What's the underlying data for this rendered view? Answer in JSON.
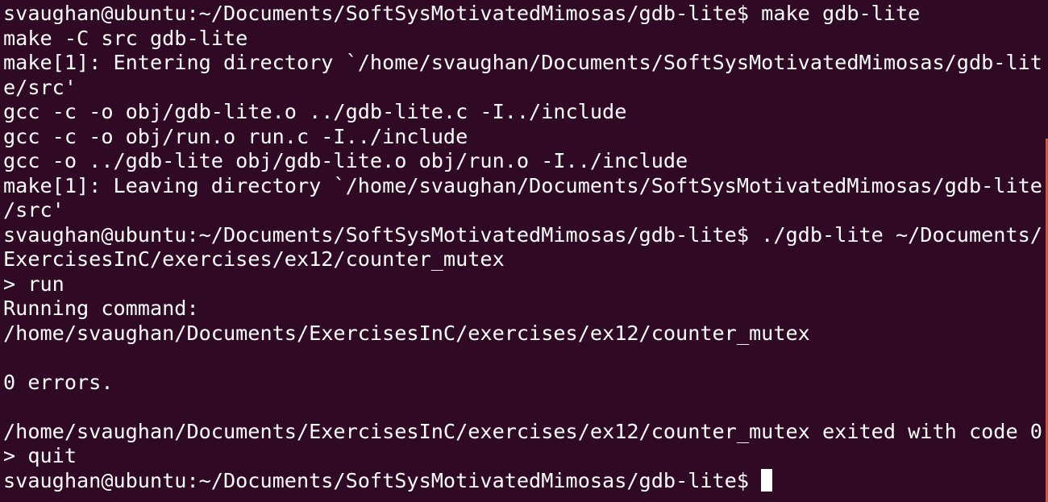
{
  "terminal": {
    "lines": [
      "svaughan@ubuntu:~/Documents/SoftSysMotivatedMimosas/gdb-lite$ make gdb-lite",
      "make -C src gdb-lite",
      "make[1]: Entering directory `/home/svaughan/Documents/SoftSysMotivatedMimosas/gdb-lit",
      "e/src'",
      "gcc -c -o obj/gdb-lite.o ../gdb-lite.c -I../include",
      "gcc -c -o obj/run.o run.c -I../include",
      "gcc -o ../gdb-lite obj/gdb-lite.o obj/run.o -I../include",
      "make[1]: Leaving directory `/home/svaughan/Documents/SoftSysMotivatedMimosas/gdb-lite",
      "/src'",
      "svaughan@ubuntu:~/Documents/SoftSysMotivatedMimosas/gdb-lite$ ./gdb-lite ~/Documents/",
      "ExercisesInC/exercises/ex12/counter_mutex",
      "> run",
      "Running command:",
      "/home/svaughan/Documents/ExercisesInC/exercises/ex12/counter_mutex",
      "",
      "0 errors.",
      "",
      "/home/svaughan/Documents/ExercisesInC/exercises/ex12/counter_mutex exited with code 0",
      "> quit"
    ],
    "prompt": "svaughan@ubuntu:~/Documents/SoftSysMotivatedMimosas/gdb-lite$"
  },
  "colors": {
    "background": "#300a24",
    "foreground": "#ffffff",
    "edge_accent": "#e9541f"
  }
}
